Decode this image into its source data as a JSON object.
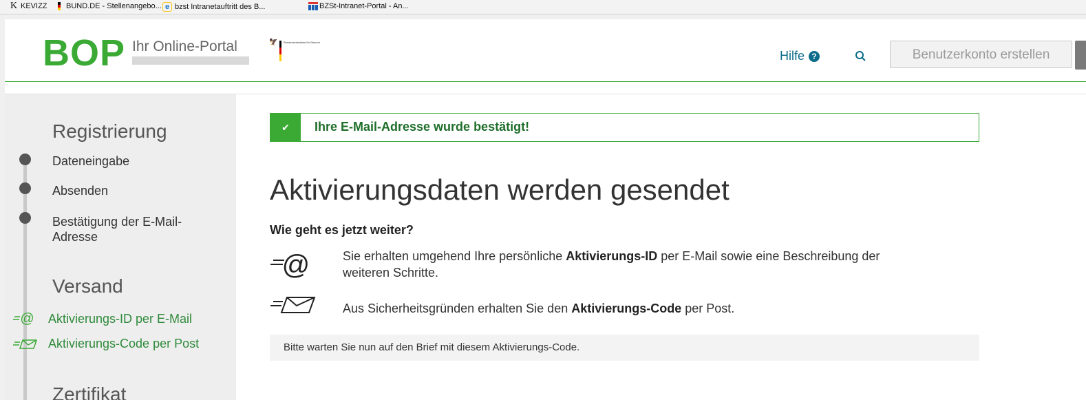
{
  "bookmarks": [
    {
      "icon": "K",
      "label": "KEVIZZ"
    },
    {
      "icon": "",
      "label": "BUND.DE - Stellenangebo..."
    },
    {
      "icon": "e",
      "label": "bzst Intranetauftritt des B..."
    },
    {
      "icon": "",
      "label": "BZSt-Intranet-Portal - An..."
    }
  ],
  "header": {
    "logo": "BOP",
    "portal_name": "Ihr Online-Portal",
    "agency_text": "Bundeszentralamt für Steuern",
    "help_label": "Hilfe",
    "help_icon": "?",
    "signup_button": "Benutzerkonto erstellen"
  },
  "sidebar": {
    "sections": {
      "registration_title": "Registrierung",
      "steps": [
        "Dateneingabe",
        "Absenden",
        "Bestätigung der E-Mail-",
        "Adresse"
      ],
      "shipping_title": "Versand",
      "shipping": [
        "Aktivierungs-ID per E-Mail",
        "Aktivierungs-Code per Post"
      ],
      "certificate_title": "Zertifikat"
    }
  },
  "main": {
    "alert": "Ihre E-Mail-Adresse wurde bestätigt!",
    "title": "Aktivierungsdaten werden gesendet",
    "subtitle": "Wie geht es jetzt weiter?",
    "email_row": {
      "pre": "Sie erhalten umgehend Ihre persönliche ",
      "bold": "Aktivierungs-ID",
      "post": " per E-Mail sowie eine Beschreibung der",
      "line2": "weiteren Schritte."
    },
    "post_row": {
      "pre": "Aus Sicherheitsgründen erhalten Sie den ",
      "bold": "Aktivierungs-Code",
      "post": " per Post."
    },
    "note": "Bitte warten Sie nun auf den Brief mit diesem Aktivierungs-Code."
  },
  "colors": {
    "brand_green": "#3aaa35",
    "link_blue": "#0b6b8a",
    "success_text": "#1f6e2a"
  }
}
